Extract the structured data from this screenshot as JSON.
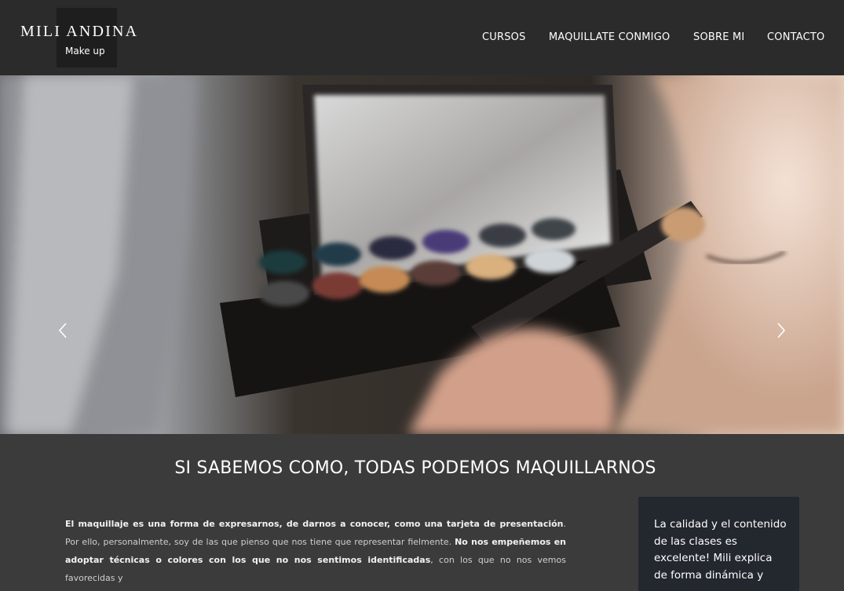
{
  "brand": {
    "title": "MILI ANDINA",
    "subtitle": "Make up"
  },
  "nav": {
    "items": [
      {
        "label": "CURSOS"
      },
      {
        "label": "MAQUILLATE CONMIGO"
      },
      {
        "label": "SOBRE MI"
      },
      {
        "label": "CONTACTO"
      }
    ]
  },
  "hero": {
    "image": "makeup-palette-photo",
    "prev_icon": "chevron-left-icon",
    "next_icon": "chevron-right-icon"
  },
  "intro": {
    "title": "SI SABEMOS COMO, TODAS PODEMOS MAQUILLARNOS",
    "p1_bold": "El maquillaje es una forma de expresarnos, de darnos a conocer, como una tarjeta de presentación",
    "p1_rest": ". Por ello, personalmente, soy de las que pienso que nos tiene que representar fielmente. ",
    "p2_bold": "No nos empeñemos en adoptar técnicas o colores con los que no nos sentimos identificadas",
    "p2_rest": ", con los que no nos vemos favorecidas y"
  },
  "testimonial": {
    "text": "La calidad y el contenido de las clases es excelente! Mili explica de forma dinámica y"
  },
  "colors": {
    "header_bg": "#2b2b2b",
    "page_bg": "#3b3b3b",
    "testimonial_bg": "#23272e"
  }
}
